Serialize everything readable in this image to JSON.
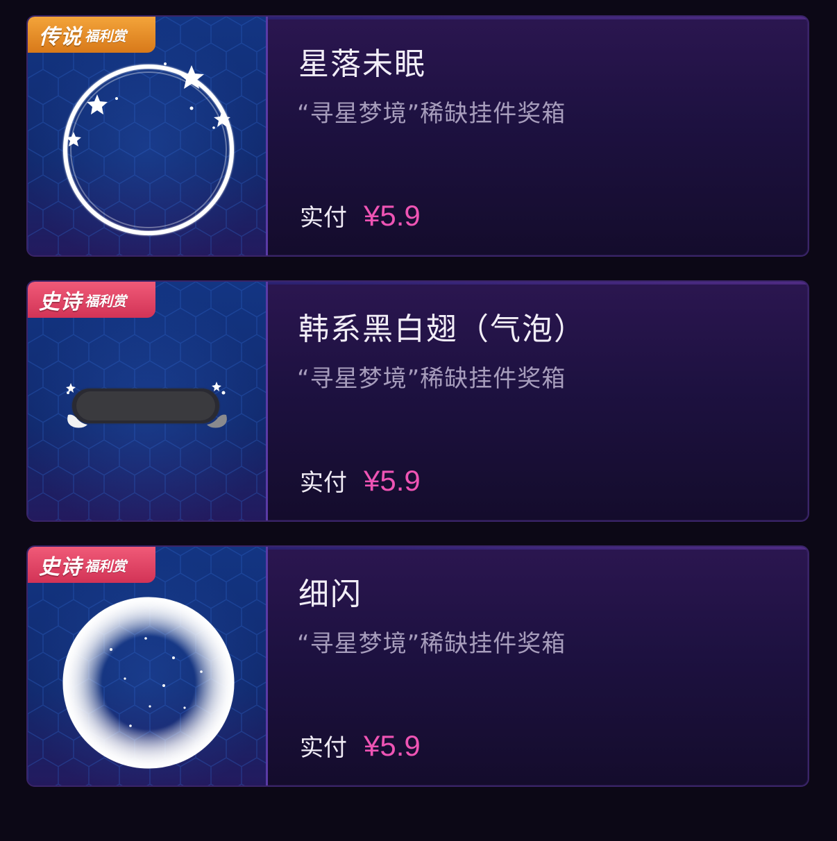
{
  "items": [
    {
      "badge_main": "传说",
      "badge_sub": "福利赏",
      "badge_color": "#e58a24",
      "title": "星落未眠",
      "subtitle": "“寻星梦境”稀缺挂件奖箱",
      "paid_label": "实付",
      "price": "¥5.9",
      "art_icon": "star-ring-frame-icon"
    },
    {
      "badge_main": "史诗",
      "badge_sub": "福利赏",
      "badge_color": "#e04466",
      "title": "韩系黑白翅（气泡）",
      "subtitle": "“寻星梦境”稀缺挂件奖箱",
      "paid_label": "实付",
      "price": "¥5.9",
      "art_icon": "black-white-wing-bubble-icon"
    },
    {
      "badge_main": "史诗",
      "badge_sub": "福利赏",
      "badge_color": "#e04466",
      "title": "细闪",
      "subtitle": "“寻星梦境”稀缺挂件奖箱",
      "paid_label": "实付",
      "price": "¥5.9",
      "art_icon": "glitter-ring-frame-icon"
    }
  ],
  "colors": {
    "background": "#0c0816",
    "card": "#1d1140",
    "price": "#ee54b4",
    "subtitle": "#a79dbc"
  }
}
